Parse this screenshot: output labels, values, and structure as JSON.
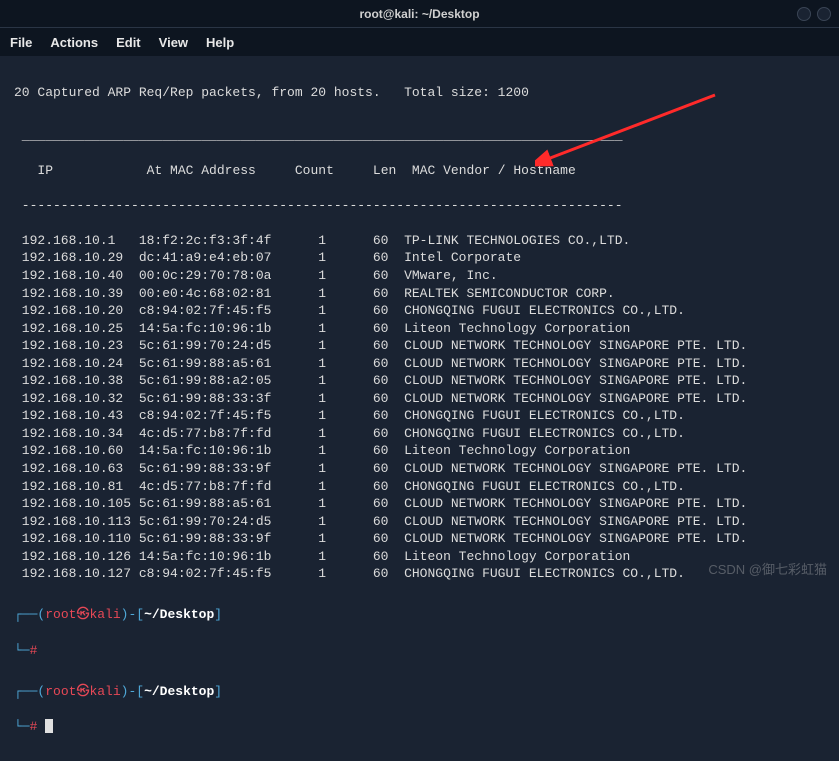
{
  "titlebar": {
    "title": "root@kali: ~/Desktop"
  },
  "menu": {
    "file": "File",
    "actions": "Actions",
    "edit": "Edit",
    "view": "View",
    "help": "Help"
  },
  "summary": "20 Captured ARP Req/Rep packets, from 20 hosts.   Total size: 1200",
  "columns": {
    "ip": "IP",
    "mac": "At MAC Address",
    "count": "Count",
    "len": "Len",
    "vendor": "MAC Vendor / Hostname"
  },
  "rows": [
    {
      "ip": "192.168.10.1",
      "mac": "18:f2:2c:f3:3f:4f",
      "count": "1",
      "len": "60",
      "vendor": "TP-LINK TECHNOLOGIES CO.,LTD."
    },
    {
      "ip": "192.168.10.29",
      "mac": "dc:41:a9:e4:eb:07",
      "count": "1",
      "len": "60",
      "vendor": "Intel Corporate"
    },
    {
      "ip": "192.168.10.40",
      "mac": "00:0c:29:70:78:0a",
      "count": "1",
      "len": "60",
      "vendor": "VMware, Inc."
    },
    {
      "ip": "192.168.10.39",
      "mac": "00:e0:4c:68:02:81",
      "count": "1",
      "len": "60",
      "vendor": "REALTEK SEMICONDUCTOR CORP."
    },
    {
      "ip": "192.168.10.20",
      "mac": "c8:94:02:7f:45:f5",
      "count": "1",
      "len": "60",
      "vendor": "CHONGQING FUGUI ELECTRONICS CO.,LTD."
    },
    {
      "ip": "192.168.10.25",
      "mac": "14:5a:fc:10:96:1b",
      "count": "1",
      "len": "60",
      "vendor": "Liteon Technology Corporation"
    },
    {
      "ip": "192.168.10.23",
      "mac": "5c:61:99:70:24:d5",
      "count": "1",
      "len": "60",
      "vendor": "CLOUD NETWORK TECHNOLOGY SINGAPORE PTE. LTD."
    },
    {
      "ip": "192.168.10.24",
      "mac": "5c:61:99:88:a5:61",
      "count": "1",
      "len": "60",
      "vendor": "CLOUD NETWORK TECHNOLOGY SINGAPORE PTE. LTD."
    },
    {
      "ip": "192.168.10.38",
      "mac": "5c:61:99:88:a2:05",
      "count": "1",
      "len": "60",
      "vendor": "CLOUD NETWORK TECHNOLOGY SINGAPORE PTE. LTD."
    },
    {
      "ip": "192.168.10.32",
      "mac": "5c:61:99:88:33:3f",
      "count": "1",
      "len": "60",
      "vendor": "CLOUD NETWORK TECHNOLOGY SINGAPORE PTE. LTD."
    },
    {
      "ip": "192.168.10.43",
      "mac": "c8:94:02:7f:45:f5",
      "count": "1",
      "len": "60",
      "vendor": "CHONGQING FUGUI ELECTRONICS CO.,LTD."
    },
    {
      "ip": "192.168.10.34",
      "mac": "4c:d5:77:b8:7f:fd",
      "count": "1",
      "len": "60",
      "vendor": "CHONGQING FUGUI ELECTRONICS CO.,LTD."
    },
    {
      "ip": "192.168.10.60",
      "mac": "14:5a:fc:10:96:1b",
      "count": "1",
      "len": "60",
      "vendor": "Liteon Technology Corporation"
    },
    {
      "ip": "192.168.10.63",
      "mac": "5c:61:99:88:33:9f",
      "count": "1",
      "len": "60",
      "vendor": "CLOUD NETWORK TECHNOLOGY SINGAPORE PTE. LTD."
    },
    {
      "ip": "192.168.10.81",
      "mac": "4c:d5:77:b8:7f:fd",
      "count": "1",
      "len": "60",
      "vendor": "CHONGQING FUGUI ELECTRONICS CO.,LTD."
    },
    {
      "ip": "192.168.10.105",
      "mac": "5c:61:99:88:a5:61",
      "count": "1",
      "len": "60",
      "vendor": "CLOUD NETWORK TECHNOLOGY SINGAPORE PTE. LTD."
    },
    {
      "ip": "192.168.10.113",
      "mac": "5c:61:99:70:24:d5",
      "count": "1",
      "len": "60",
      "vendor": "CLOUD NETWORK TECHNOLOGY SINGAPORE PTE. LTD."
    },
    {
      "ip": "192.168.10.110",
      "mac": "5c:61:99:88:33:9f",
      "count": "1",
      "len": "60",
      "vendor": "CLOUD NETWORK TECHNOLOGY SINGAPORE PTE. LTD."
    },
    {
      "ip": "192.168.10.126",
      "mac": "14:5a:fc:10:96:1b",
      "count": "1",
      "len": "60",
      "vendor": "Liteon Technology Corporation"
    },
    {
      "ip": "192.168.10.127",
      "mac": "c8:94:02:7f:45:f5",
      "count": "1",
      "len": "60",
      "vendor": "CHONGQING FUGUI ELECTRONICS CO.,LTD."
    }
  ],
  "prompt": {
    "open": "┌──(",
    "user": "root",
    "sep": "㉿",
    "host": "kali",
    "close": ")-[",
    "path": "~/Desktop",
    "end": "]",
    "line2": "└─",
    "hash": "#"
  },
  "watermark": "CSDN @御七彩虹猫"
}
